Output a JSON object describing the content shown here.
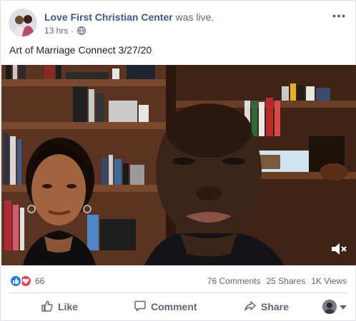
{
  "post": {
    "author": "Love First Christian Center",
    "action": "was live.",
    "time": "13 hrs",
    "text": "Art of Marriage Connect 3/27/20"
  },
  "stats": {
    "reaction_count": "66",
    "comments": "76 Comments",
    "shares": "25 Shares",
    "views": "1K Views"
  },
  "actions": {
    "like": "Like",
    "comment": "Comment",
    "share": "Share"
  },
  "colors": {
    "author_link": "#385898",
    "like_blue": "#2078f4",
    "love_red": "#f33e58"
  },
  "icons": {
    "privacy": "globe-icon",
    "more": "more-dots-icon",
    "mute": "speaker-muted-icon"
  }
}
